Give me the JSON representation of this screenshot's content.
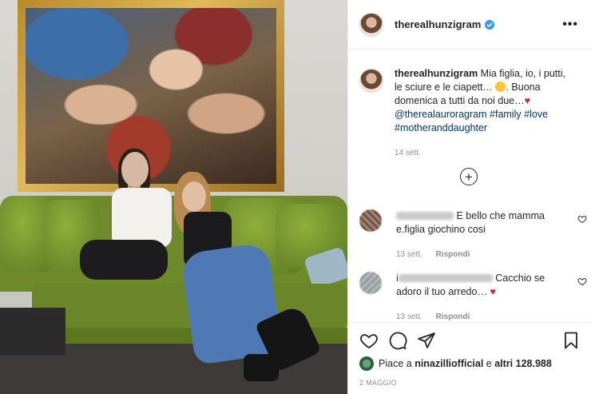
{
  "post": {
    "username": "therealhunzigram",
    "verified": true,
    "more_label": "•••"
  },
  "caption": {
    "username": "therealhunzigram",
    "text_part1": "Mia figlia, io, i putti, le sciure e le ciapett…",
    "text_part2": ". Buona domenica a tutti da noi due…",
    "mention": "@therealauroragram",
    "hashtags": [
      "#family",
      "#love",
      "#motheranddaughter"
    ],
    "time": "14 sett."
  },
  "load_more_label": "+",
  "comments": [
    {
      "text": "E bello che mamma e.figlia giochino cosi",
      "time": "13 sett.",
      "reply_label": "Rispondi"
    },
    {
      "prefix": "i",
      "text": "Cacchio se adoro il tuo arredo…",
      "time": "13 sett.",
      "reply_label": "Rispondi"
    }
  ],
  "likes": {
    "prefix": "Piace a",
    "user": "ninazilliofficial",
    "connector": "e",
    "others": "altri 128.988"
  },
  "post_date": "2 MAGGIO",
  "icons": [
    "heart-icon",
    "comment-icon",
    "share-icon",
    "bookmark-icon",
    "verified-icon",
    "plus-circle-icon"
  ],
  "colors": {
    "link": "#00376b",
    "verified": "#3897f0",
    "heart": "#d8232a",
    "muted": "#8e8e8e"
  }
}
